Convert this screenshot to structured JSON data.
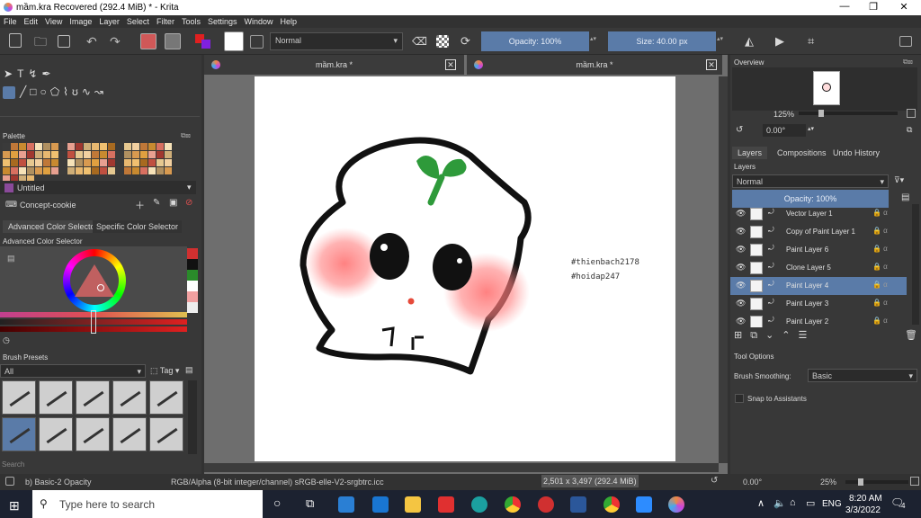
{
  "window": {
    "title": "mầm.kra Recovered (292.4 MiB) * - Krita"
  },
  "menu": [
    "File",
    "Edit",
    "View",
    "Image",
    "Layer",
    "Select",
    "Filter",
    "Tools",
    "Settings",
    "Window",
    "Help"
  ],
  "toolbar": {
    "blend_mode": "Normal",
    "opacity": "Opacity: 100%",
    "size": "Size: 40.00 px"
  },
  "left": {
    "palette_title": "Palette",
    "palette_name": "Untitled",
    "resource": "Concept-cookie",
    "tabs": [
      "Advanced Color Selector",
      "Specific Color Selector"
    ],
    "adv_title": "Advanced Color Selector",
    "brush_title": "Brush Presets",
    "brush_filter": "All",
    "tag": "Tag",
    "search": "Search"
  },
  "tabs": [
    "mầm.kra *",
    "mầm.kra *"
  ],
  "canvas": {
    "tag1": "#thienbach2178",
    "tag2": "#hoidap247"
  },
  "right": {
    "overview_title": "Overview",
    "zoom": "125%",
    "rotation": "0.00°",
    "tabs": [
      "Layers",
      "Compositions",
      "Undo History"
    ],
    "layers_title": "Layers",
    "blend": "Normal",
    "opacity": "Opacity: 100%",
    "layers": [
      "Vector Layer 1",
      "Copy of Paint Layer 1",
      "Paint Layer 6",
      "Clone Layer 5",
      "Paint Layer 4",
      "Paint Layer 3",
      "Paint Layer 2"
    ],
    "tool_options": "Tool Options",
    "smoothing_label": "Brush Smoothing:",
    "smoothing_value": "Basic",
    "snap": "Snap to Assistants"
  },
  "status": {
    "brush": "b) Basic-2 Opacity",
    "color": "RGB/Alpha (8-bit integer/channel)  sRGB-elle-V2-srgbtrc.icc",
    "dims": "2,501 x 3,497 (292.4 MiB)",
    "rotation": "0.00°",
    "zoom": "25%"
  },
  "taskbar": {
    "search": "Type here to search",
    "lang": "ENG",
    "time": "8:20 AM",
    "date": "3/3/2022",
    "notif": "4"
  },
  "colors": {
    "accent": "#5a7ba8",
    "fg_color": "#e05050"
  }
}
